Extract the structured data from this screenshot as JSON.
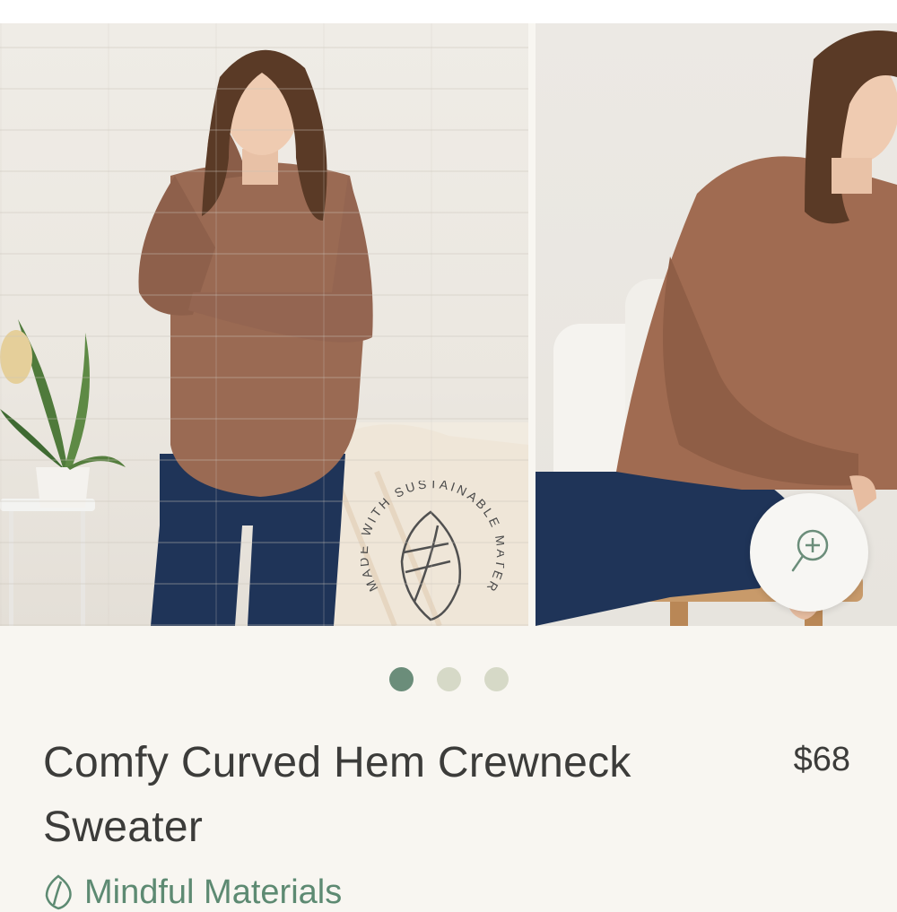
{
  "carousel": {
    "images": [
      {
        "alt": "Model wearing sweater standing",
        "badge_text": "MADE WITH SUSTAINABLE MATERIALS"
      },
      {
        "alt": "Model wearing sweater seated"
      }
    ],
    "dots": [
      {
        "active": true
      },
      {
        "active": false
      },
      {
        "active": false
      }
    ],
    "zoom_icon": "zoom-in-icon"
  },
  "product": {
    "title": "Comfy Curved Hem Crewneck Sweater",
    "price": "$68",
    "tag": {
      "label": "Mindful Materials",
      "icon": "leaf-icon"
    }
  },
  "colors": {
    "accent": "#6b8d7a",
    "dot_inactive": "#d6d9c7",
    "text": "#3c3c3a",
    "tag_text": "#5d8a72",
    "background": "#f8f6f1"
  }
}
